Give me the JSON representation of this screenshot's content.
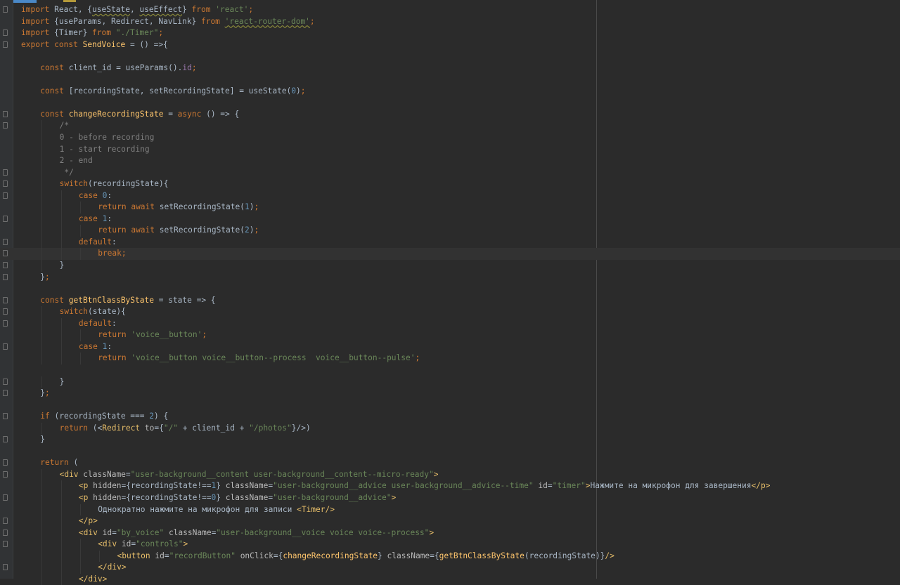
{
  "editor": {
    "lines": [
      {
        "fold": true,
        "hl": false,
        "indent": 0,
        "tokens": [
          [
            "k",
            "import"
          ],
          [
            "d",
            " React, {"
          ],
          [
            "d u",
            "useState"
          ],
          [
            "d",
            ", "
          ],
          [
            "d u",
            "useEffect"
          ],
          [
            "d",
            "} "
          ],
          [
            "k",
            "from"
          ],
          [
            "d",
            " "
          ],
          [
            "s",
            "'react'"
          ],
          [
            "k",
            ";"
          ]
        ]
      },
      {
        "fold": false,
        "hl": false,
        "indent": 0,
        "tokens": [
          [
            "k",
            "import"
          ],
          [
            "d",
            " {useParams, Redirect, NavLink} "
          ],
          [
            "k",
            "from"
          ],
          [
            "d",
            " "
          ],
          [
            "s u",
            "'react-router-dom'"
          ],
          [
            "k",
            ";"
          ]
        ]
      },
      {
        "fold": true,
        "hl": false,
        "indent": 0,
        "tokens": [
          [
            "k",
            "import"
          ],
          [
            "d",
            " {Timer} "
          ],
          [
            "k",
            "from"
          ],
          [
            "d",
            " "
          ],
          [
            "s",
            "\"./Timer\""
          ],
          [
            "k",
            ";"
          ]
        ]
      },
      {
        "fold": true,
        "hl": false,
        "indent": 0,
        "tokens": [
          [
            "k",
            "export const"
          ],
          [
            "d",
            " "
          ],
          [
            "f",
            "SendVoice"
          ],
          [
            "d",
            " = () =>{"
          ]
        ]
      },
      {
        "fold": false,
        "hl": false,
        "indent": 0,
        "tokens": []
      },
      {
        "fold": false,
        "hl": false,
        "indent": 1,
        "tokens": [
          [
            "k",
            "const"
          ],
          [
            "d",
            " client_id = useParams()."
          ],
          [
            "p",
            "id"
          ],
          [
            "k",
            ";"
          ]
        ]
      },
      {
        "fold": false,
        "hl": false,
        "indent": 0,
        "tokens": []
      },
      {
        "fold": false,
        "hl": false,
        "indent": 1,
        "tokens": [
          [
            "k",
            "const"
          ],
          [
            "d",
            " [recordingState, setRecordingState] = useState("
          ],
          [
            "n",
            "0"
          ],
          [
            "d",
            ")"
          ],
          [
            "k",
            ";"
          ]
        ]
      },
      {
        "fold": false,
        "hl": false,
        "indent": 0,
        "tokens": []
      },
      {
        "fold": true,
        "hl": false,
        "indent": 1,
        "tokens": [
          [
            "k",
            "const"
          ],
          [
            "d",
            " "
          ],
          [
            "f",
            "changeRecordingState"
          ],
          [
            "d",
            " = "
          ],
          [
            "k",
            "async"
          ],
          [
            "d",
            " () => {"
          ]
        ]
      },
      {
        "fold": true,
        "hl": false,
        "indent": 2,
        "tokens": [
          [
            "c",
            "/*"
          ]
        ]
      },
      {
        "fold": false,
        "hl": false,
        "indent": 2,
        "tokens": [
          [
            "c",
            "0 - before recording"
          ]
        ]
      },
      {
        "fold": false,
        "hl": false,
        "indent": 2,
        "tokens": [
          [
            "c",
            "1 - start recording"
          ]
        ]
      },
      {
        "fold": false,
        "hl": false,
        "indent": 2,
        "tokens": [
          [
            "c",
            "2 - end"
          ]
        ]
      },
      {
        "fold": true,
        "hl": false,
        "indent": 2,
        "tokens": [
          [
            "c",
            " */"
          ]
        ]
      },
      {
        "fold": true,
        "hl": false,
        "indent": 2,
        "tokens": [
          [
            "k",
            "switch"
          ],
          [
            "d",
            "(recordingState){"
          ]
        ]
      },
      {
        "fold": true,
        "hl": false,
        "indent": 3,
        "tokens": [
          [
            "k",
            "case"
          ],
          [
            "d",
            " "
          ],
          [
            "n",
            "0"
          ],
          [
            "d",
            ":"
          ]
        ]
      },
      {
        "fold": false,
        "hl": false,
        "indent": 4,
        "tokens": [
          [
            "k",
            "return await"
          ],
          [
            "d",
            " setRecordingState("
          ],
          [
            "n",
            "1"
          ],
          [
            "d",
            ")"
          ],
          [
            "k",
            ";"
          ]
        ]
      },
      {
        "fold": true,
        "hl": false,
        "indent": 3,
        "tokens": [
          [
            "k",
            "case"
          ],
          [
            "d",
            " "
          ],
          [
            "n",
            "1"
          ],
          [
            "d",
            ":"
          ]
        ]
      },
      {
        "fold": false,
        "hl": false,
        "indent": 4,
        "tokens": [
          [
            "k",
            "return await"
          ],
          [
            "d",
            " setRecordingState("
          ],
          [
            "n",
            "2"
          ],
          [
            "d",
            ")"
          ],
          [
            "k",
            ";"
          ]
        ]
      },
      {
        "fold": true,
        "hl": false,
        "indent": 3,
        "tokens": [
          [
            "k",
            "default"
          ],
          [
            "d",
            ":"
          ]
        ]
      },
      {
        "fold": true,
        "hl": true,
        "indent": 4,
        "tokens": [
          [
            "k",
            "break;"
          ]
        ]
      },
      {
        "fold": true,
        "hl": false,
        "indent": 2,
        "tokens": [
          [
            "d",
            "}"
          ]
        ]
      },
      {
        "fold": true,
        "hl": false,
        "indent": 1,
        "tokens": [
          [
            "d",
            "}"
          ],
          [
            "k",
            ";"
          ]
        ]
      },
      {
        "fold": false,
        "hl": false,
        "indent": 0,
        "tokens": []
      },
      {
        "fold": true,
        "hl": false,
        "indent": 1,
        "tokens": [
          [
            "k",
            "const"
          ],
          [
            "d",
            " "
          ],
          [
            "f",
            "getBtnClassByState"
          ],
          [
            "d",
            " = state => {"
          ]
        ]
      },
      {
        "fold": true,
        "hl": false,
        "indent": 2,
        "tokens": [
          [
            "k",
            "switch"
          ],
          [
            "d",
            "(state){"
          ]
        ]
      },
      {
        "fold": true,
        "hl": false,
        "indent": 3,
        "tokens": [
          [
            "k",
            "default"
          ],
          [
            "d",
            ":"
          ]
        ]
      },
      {
        "fold": false,
        "hl": false,
        "indent": 4,
        "tokens": [
          [
            "k",
            "return"
          ],
          [
            "d",
            " "
          ],
          [
            "s",
            "'voice__button'"
          ],
          [
            "k",
            ";"
          ]
        ]
      },
      {
        "fold": true,
        "hl": false,
        "indent": 3,
        "tokens": [
          [
            "k",
            "case"
          ],
          [
            "d",
            " "
          ],
          [
            "n",
            "1"
          ],
          [
            "d",
            ":"
          ]
        ]
      },
      {
        "fold": false,
        "hl": false,
        "indent": 4,
        "tokens": [
          [
            "k",
            "return"
          ],
          [
            "d",
            " "
          ],
          [
            "s",
            "'voice__button voice__button--process  voice__button--pulse'"
          ],
          [
            "k",
            ";"
          ]
        ]
      },
      {
        "fold": false,
        "hl": false,
        "indent": 0,
        "tokens": []
      },
      {
        "fold": true,
        "hl": false,
        "indent": 2,
        "tokens": [
          [
            "d",
            "}"
          ]
        ]
      },
      {
        "fold": true,
        "hl": false,
        "indent": 1,
        "tokens": [
          [
            "d",
            "}"
          ],
          [
            "k",
            ";"
          ]
        ]
      },
      {
        "fold": false,
        "hl": false,
        "indent": 0,
        "tokens": []
      },
      {
        "fold": true,
        "hl": false,
        "indent": 1,
        "tokens": [
          [
            "k",
            "if"
          ],
          [
            "d",
            " (recordingState === "
          ],
          [
            "n",
            "2"
          ],
          [
            "d",
            ") {"
          ]
        ]
      },
      {
        "fold": false,
        "hl": false,
        "indent": 2,
        "tokens": [
          [
            "k",
            "return"
          ],
          [
            "d",
            " (<"
          ],
          [
            "t",
            "Redirect"
          ],
          [
            "d",
            " "
          ],
          [
            "a",
            "to"
          ],
          [
            "d",
            "={"
          ],
          [
            "s",
            "\"/\""
          ],
          [
            "d",
            " + client_id + "
          ],
          [
            "s",
            "\"/photos\""
          ],
          [
            "d",
            "}/>)"
          ]
        ]
      },
      {
        "fold": true,
        "hl": false,
        "indent": 1,
        "tokens": [
          [
            "d",
            "}"
          ]
        ]
      },
      {
        "fold": false,
        "hl": false,
        "indent": 0,
        "tokens": []
      },
      {
        "fold": true,
        "hl": false,
        "indent": 1,
        "tokens": [
          [
            "k",
            "return"
          ],
          [
            "d",
            " ("
          ]
        ]
      },
      {
        "fold": true,
        "hl": false,
        "indent": 2,
        "tokens": [
          [
            "t",
            "<div"
          ],
          [
            "d",
            " "
          ],
          [
            "a",
            "className"
          ],
          [
            "d",
            "="
          ],
          [
            "s",
            "\"user-background__content user-background__content--micro-ready\""
          ],
          [
            "t",
            ">"
          ]
        ]
      },
      {
        "fold": false,
        "hl": false,
        "indent": 3,
        "tokens": [
          [
            "t",
            "<p"
          ],
          [
            "d",
            " "
          ],
          [
            "a",
            "hidden"
          ],
          [
            "d",
            "={recordingState!=="
          ],
          [
            "n",
            "1"
          ],
          [
            "d",
            "} "
          ],
          [
            "a",
            "className"
          ],
          [
            "d",
            "="
          ],
          [
            "s",
            "\"user-background__advice user-background__advice--time\""
          ],
          [
            "d",
            " "
          ],
          [
            "a",
            "id"
          ],
          [
            "d",
            "="
          ],
          [
            "s",
            "\"timer\""
          ],
          [
            "t",
            ">"
          ],
          [
            "d",
            "Нажмите на микрофон для завершения"
          ],
          [
            "t",
            "</p>"
          ]
        ]
      },
      {
        "fold": true,
        "hl": false,
        "indent": 3,
        "tokens": [
          [
            "t",
            "<p"
          ],
          [
            "d",
            " "
          ],
          [
            "a",
            "hidden"
          ],
          [
            "d",
            "={recordingState!=="
          ],
          [
            "n",
            "0"
          ],
          [
            "d",
            "} "
          ],
          [
            "a",
            "className"
          ],
          [
            "d",
            "="
          ],
          [
            "s",
            "\"user-background__advice\""
          ],
          [
            "t",
            ">"
          ]
        ]
      },
      {
        "fold": false,
        "hl": false,
        "indent": 4,
        "tokens": [
          [
            "d",
            "Однократно нажмите на микрофон для записи "
          ],
          [
            "t",
            "<Timer/>"
          ]
        ]
      },
      {
        "fold": true,
        "hl": false,
        "indent": 3,
        "tokens": [
          [
            "t",
            "</p>"
          ]
        ]
      },
      {
        "fold": true,
        "hl": false,
        "indent": 3,
        "tokens": [
          [
            "t",
            "<div"
          ],
          [
            "d",
            " "
          ],
          [
            "a",
            "id"
          ],
          [
            "d",
            "="
          ],
          [
            "s",
            "\"by_voice\""
          ],
          [
            "d",
            " "
          ],
          [
            "a",
            "className"
          ],
          [
            "d",
            "="
          ],
          [
            "s",
            "\"user-background__voice voice voice--process\""
          ],
          [
            "t",
            ">"
          ]
        ]
      },
      {
        "fold": true,
        "hl": false,
        "indent": 4,
        "tokens": [
          [
            "t",
            "<div"
          ],
          [
            "d",
            " "
          ],
          [
            "a",
            "id"
          ],
          [
            "d",
            "="
          ],
          [
            "s",
            "\"controls\""
          ],
          [
            "t",
            ">"
          ]
        ]
      },
      {
        "fold": false,
        "hl": false,
        "indent": 5,
        "tokens": [
          [
            "t",
            "<button"
          ],
          [
            "d",
            " "
          ],
          [
            "a",
            "id"
          ],
          [
            "d",
            "="
          ],
          [
            "s",
            "\"recordButton\""
          ],
          [
            "d",
            " "
          ],
          [
            "a",
            "onClick"
          ],
          [
            "d",
            "={"
          ],
          [
            "f",
            "changeRecordingState"
          ],
          [
            "d",
            "} "
          ],
          [
            "a",
            "className"
          ],
          [
            "d",
            "={"
          ],
          [
            "f",
            "getBtnClassByState"
          ],
          [
            "d",
            "(recordingState)}"
          ],
          [
            "t",
            "/>"
          ]
        ]
      },
      {
        "fold": true,
        "hl": false,
        "indent": 4,
        "tokens": [
          [
            "t",
            "</div>"
          ]
        ]
      },
      {
        "fold": false,
        "hl": false,
        "indent": 3,
        "tokens": [
          [
            "t",
            "</div>"
          ]
        ]
      }
    ]
  }
}
